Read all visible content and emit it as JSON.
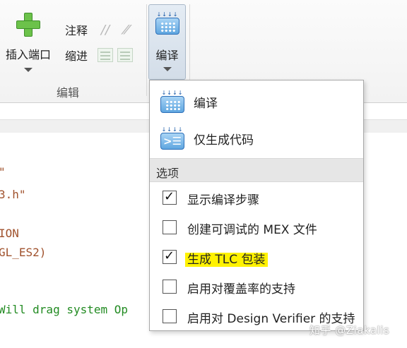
{
  "ribbon": {
    "insert_port_label": "插入端口",
    "comment_label": "注释",
    "indent_label": "缩进",
    "edit_group_label": "编辑",
    "compile_button_label": "编译"
  },
  "code": {
    "lines": [
      {
        "text": "\"",
        "kind": "str"
      },
      {
        "text": "3.h\"",
        "kind": "str"
      },
      {
        "text": "ION",
        "kind": "str"
      },
      {
        "text": "GL_ES2)",
        "kind": "str"
      },
      {
        "text": "Will drag system Op",
        "kind": "cmt"
      }
    ]
  },
  "dropdown": {
    "compile_item": "编译",
    "codegen_item": "仅生成代码",
    "section_label": "选项",
    "options": [
      {
        "label": "显示编译步骤",
        "checked": true
      },
      {
        "label": "创建可调试的 MEX 文件",
        "checked": false
      },
      {
        "label": "生成 TLC 包装",
        "checked": true,
        "highlighted": true
      },
      {
        "label": "启用对覆盖率的支持",
        "checked": false
      },
      {
        "label": "启用对 Design Verifier 的支持",
        "checked": false
      }
    ]
  },
  "watermark": "知乎 @Ziakalis",
  "colors": {
    "highlight": "#fff200",
    "plus_green": "#6cc24a",
    "compile_blue": "#5fa6e0",
    "string_color": "#a0522d",
    "comment_color": "#228b22"
  }
}
